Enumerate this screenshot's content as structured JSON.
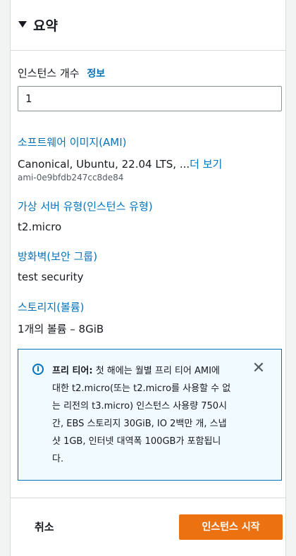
{
  "header": {
    "title": "요약",
    "caret_icon": "caret-down-icon"
  },
  "instances": {
    "label": "인스턴스 개수",
    "info_link": "정보",
    "value": "1"
  },
  "ami": {
    "heading": "소프트웨어 이미지(AMI)",
    "value": "Canonical, Ubuntu, 22.04 LTS, ...",
    "more_link": "더 보기",
    "id": "ami-0e9bfdb247cc8de84"
  },
  "instance_type": {
    "heading": "가상 서버 유형(인스턴스 유형)",
    "value": "t2.micro"
  },
  "firewall": {
    "heading": "방화벽(보안 그룹)",
    "value": "test security"
  },
  "storage": {
    "heading": "스토리지(볼륨)",
    "value": "1개의 볼륨 – 8GiB"
  },
  "alert": {
    "icon": "info-icon",
    "title": "프리 티어:",
    "lines": [
      " 첫 해에는 월별 프리 티어 AMI에",
      "대한 t2.micro(또는 t2.micro를 사용할 수 없",
      "는 리전의 t3.micro) 인스턴스 사용량 750시",
      "간, EBS 스토리지 30GiB, IO 2백만 개, 스냅",
      "샷 1GB, 인터넷 대역폭 100GB가 포함됩니",
      "다."
    ],
    "close_icon": "close-icon"
  },
  "footer": {
    "cancel_label": "취소",
    "launch_label": "인스턴스 시작"
  },
  "colors": {
    "accent": "#0073bb",
    "primary_button": "#ec7211",
    "alert_bg": "#f1faff"
  }
}
